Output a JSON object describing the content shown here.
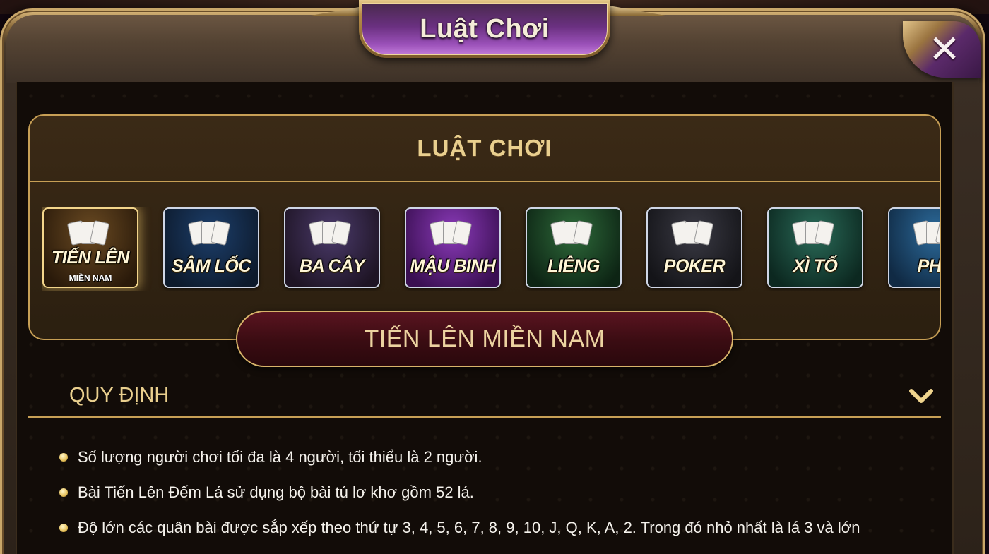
{
  "window": {
    "title": "Luật Chơi",
    "close_label": "✕"
  },
  "section": {
    "title": "LUẬT CHƠI"
  },
  "games": [
    {
      "label": "TIẾN LÊN",
      "sub": "MIỀN NAM",
      "active": true,
      "color_top": "#6a4a22",
      "color_bottom": "#2a1a0a"
    },
    {
      "label": "SÂM LỐC",
      "sub": "",
      "active": false,
      "color_top": "#1c3e6a",
      "color_bottom": "#0d1a2c"
    },
    {
      "label": "BA CÂY",
      "sub": "",
      "active": false,
      "color_top": "#4a3a6a",
      "color_bottom": "#1e1424"
    },
    {
      "label": "MẬU BINH",
      "sub": "",
      "active": false,
      "color_top": "#8a3ab8",
      "color_bottom": "#3a0f52"
    },
    {
      "label": "LIÊNG",
      "sub": "",
      "active": false,
      "color_top": "#2e6a3a",
      "color_bottom": "#0d2414"
    },
    {
      "label": "POKER",
      "sub": "",
      "active": false,
      "color_top": "#3a3a44",
      "color_bottom": "#141418"
    },
    {
      "label": "XÌ TỐ",
      "sub": "",
      "active": false,
      "color_top": "#2a6a58",
      "color_bottom": "#0c2820"
    },
    {
      "label": "PHỎ",
      "sub": "",
      "active": false,
      "color_top": "#2c6a9a",
      "color_bottom": "#102a44"
    }
  ],
  "selected_game": {
    "title": "TIẾN LÊN MIỀN NAM"
  },
  "rules": {
    "heading": "QUY ĐỊNH",
    "items": [
      "Số lượng người chơi tối đa là 4 người, tối thiểu là 2 người.",
      "Bài Tiến Lên Đếm Lá sử dụng bộ bài tú lơ khơ gồm 52 lá.",
      "Độ lớn các quân bài được sắp xếp theo thứ tự 3, 4, 5, 6, 7, 8, 9, 10, J, Q, K, A, 2. Trong đó nhỏ nhất là lá 3 và lớn"
    ]
  },
  "colors": {
    "gold": "#c79f55",
    "gold_text": "#e9cf8e",
    "banner": "#5a1420",
    "plaque": "#6a3080"
  }
}
